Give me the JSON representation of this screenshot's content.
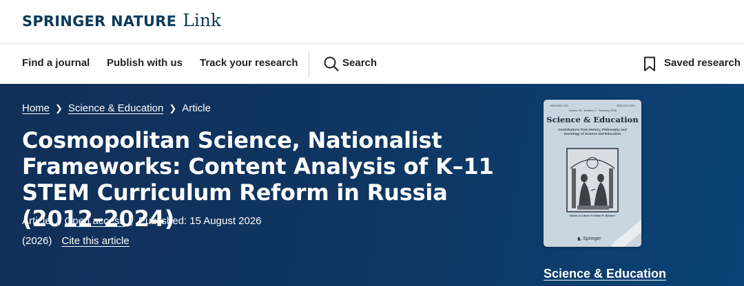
{
  "brand": {
    "name": "Springer Nature",
    "product": "Link"
  },
  "nav": {
    "find_journal": "Find a journal",
    "publish": "Publish with us",
    "track": "Track your research",
    "search": "Search",
    "saved": "Saved research"
  },
  "breadcrumb": {
    "home": "Home",
    "journal": "Science & Education",
    "current": "Article"
  },
  "article": {
    "title": "Cosmopolitan Science, Nationalist Frameworks: Content Analysis of K–11 STEM Curriculum Reform in Russia (2012–2024)",
    "type": "Article",
    "access": "Open access",
    "published": "Published: 15 August 2026",
    "year": "(2026)",
    "cite": "Cite this article"
  },
  "cover": {
    "issn_left": "ISSN 0926-7220",
    "issn_right": "ISSN 1573-1901",
    "volume": "Volume 35 · Number 1 · February 2026",
    "title": "Science & Education",
    "subtitle": "Contributions from History, Philosophy and Sociology of Science and Education",
    "editor": "Editor-in-Chief: Kristian H. Nielsen",
    "publisher": "Springer"
  },
  "journal_link": "Science & Education",
  "colors": {
    "hero": "#0f3560",
    "brand": "#0c3b5b"
  },
  "icons": {
    "search": "search-icon",
    "saved": "bookmark-icon",
    "breadcrumb_sep": "chevron-right-icon"
  }
}
